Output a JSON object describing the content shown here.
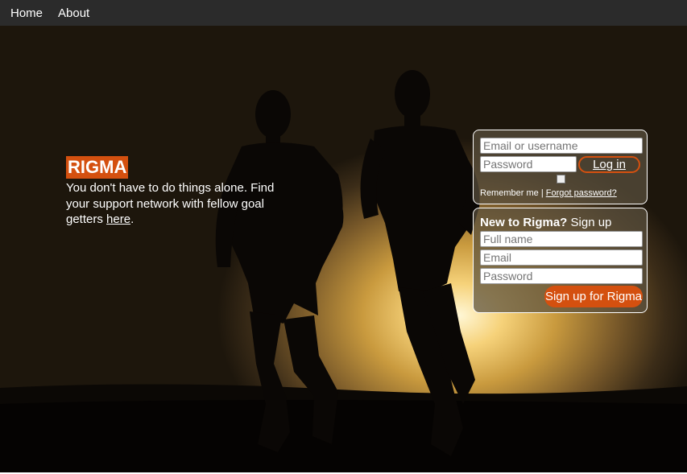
{
  "nav": {
    "home": "Home",
    "about": "About"
  },
  "hero": {
    "brand": "RIGMA",
    "tagline": "You don't have to do things alone. Find your support network with fellow goal getters ",
    "tagline_link": "here",
    "tagline_end": "."
  },
  "login": {
    "email_placeholder": "Email or username",
    "password_placeholder": "Password",
    "login_label": "Log in",
    "remember_label": "Remember me",
    "separator": "|",
    "forgot_label": "Forgot password?"
  },
  "signup": {
    "heading_bold": "New to Rigma?",
    "heading_rest": " Sign up",
    "fullname_placeholder": "Full name",
    "email_placeholder": "Email",
    "password_placeholder": "Password",
    "submit_label": "Sign up for Rigma"
  },
  "colors": {
    "accent": "#d4500f",
    "navbar": "#2b2b2b"
  }
}
